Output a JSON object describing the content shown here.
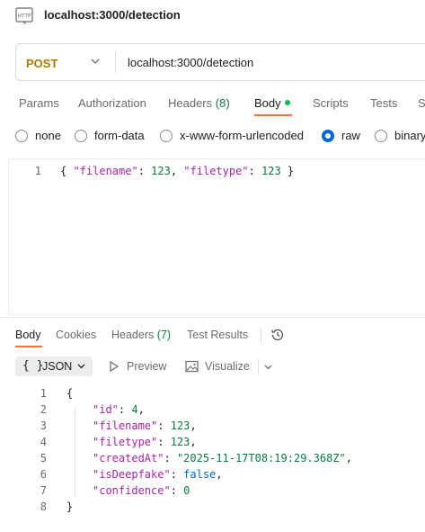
{
  "title": {
    "text": "localhost:3000/detection",
    "icon": "http-file-icon",
    "icon_text": "HTTP"
  },
  "request": {
    "method": "POST",
    "method_color": "#ad7a03",
    "url": "localhost:3000/detection"
  },
  "request_tabs": [
    {
      "label": "Params"
    },
    {
      "label": "Authorization"
    },
    {
      "label": "Headers",
      "count": "(8)"
    },
    {
      "label": "Body",
      "active": true
    },
    {
      "label": "Scripts"
    },
    {
      "label": "Tests"
    },
    {
      "label": "S"
    }
  ],
  "body_types": [
    {
      "label": "none",
      "checked": false
    },
    {
      "label": "form-data",
      "checked": false
    },
    {
      "label": "x-www-form-urlencoded",
      "checked": false
    },
    {
      "label": "raw",
      "checked": true
    },
    {
      "label": "binary",
      "checked": false
    }
  ],
  "request_body": {
    "lines": [
      {
        "num": "1",
        "text": "{ \"filename\": 123, \"filetype\": 123 }"
      }
    ]
  },
  "response_tabs": [
    {
      "label": "Body",
      "active": true
    },
    {
      "label": "Cookies"
    },
    {
      "label": "Headers",
      "count": "(7)"
    },
    {
      "label": "Test Results"
    }
  ],
  "view_toolbar": {
    "braces": "{ }",
    "format": "JSON",
    "preview": "Preview",
    "visualize": "Visualize"
  },
  "response_body": {
    "lines": [
      {
        "num": "1",
        "text": "{"
      },
      {
        "num": "2",
        "text": "\"id\": 4,"
      },
      {
        "num": "3",
        "text": "\"filename\": 123,"
      },
      {
        "num": "4",
        "text": "\"filetype\": 123,"
      },
      {
        "num": "5",
        "text": "\"createdAt\": \"2025-11-17T08:19:29.368Z\","
      },
      {
        "num": "6",
        "text": "\"isDeepfake\": false,"
      },
      {
        "num": "7",
        "text": "\"confidence\": 0"
      },
      {
        "num": "8",
        "text": "}"
      }
    ]
  },
  "colors": {
    "accent": "#ff6c37",
    "radio_checked": "#0265d2",
    "success": "#0cbb52"
  }
}
